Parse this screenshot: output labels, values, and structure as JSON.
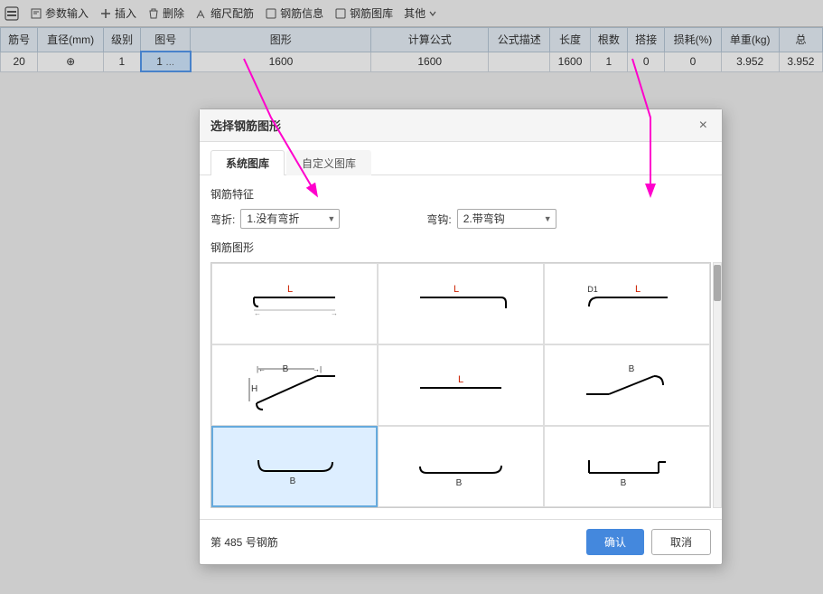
{
  "toolbar": {
    "items": [
      {
        "id": "params-input",
        "label": "参数输入",
        "icon": "edit-icon"
      },
      {
        "id": "insert",
        "label": "插入",
        "icon": "insert-icon"
      },
      {
        "id": "delete",
        "label": "删除",
        "icon": "delete-icon"
      },
      {
        "id": "scale-match",
        "label": "缩尺配筋",
        "icon": "scale-icon"
      },
      {
        "id": "rebar-info",
        "label": "钢筋信息",
        "icon": "info-icon"
      },
      {
        "id": "rebar-lib",
        "label": "钢筋图库",
        "icon": "lib-icon"
      },
      {
        "id": "other",
        "label": "其他",
        "icon": "other-icon"
      }
    ]
  },
  "table": {
    "headers": [
      "筋号",
      "直径(mm)",
      "级别",
      "图号",
      "图形",
      "计算公式",
      "公式描述",
      "长度",
      "根数",
      "搭接",
      "损耗(%)",
      "单重(kg)",
      "总"
    ],
    "row": {
      "jinhao": "20",
      "diameter": "⊕",
      "level": "1",
      "tuhao": "1",
      "tuhao_extra": "...",
      "figure": "1600",
      "formula": "1600",
      "description": "",
      "length": "1600",
      "genshu": "1",
      "dajie": "0",
      "sunhao": "0",
      "weight": "3.952",
      "total": "3.952"
    }
  },
  "modal": {
    "title": "选择钢筋图形",
    "close_label": "×",
    "tabs": [
      {
        "id": "system-lib",
        "label": "系统图库",
        "active": true
      },
      {
        "id": "custom-lib",
        "label": "自定义图库",
        "active": false
      }
    ],
    "props_label": "钢筋特征",
    "bend_label": "弯折:",
    "bend_value": "1.没有弯折",
    "hook_label": "弯钩:",
    "hook_value": "2.带弯钩",
    "shapes_label": "钢筋图形",
    "shapes": [
      {
        "id": 1,
        "row": 0,
        "col": 0,
        "label": "straight-L",
        "selected": false
      },
      {
        "id": 2,
        "row": 0,
        "col": 1,
        "label": "straight-L-hook",
        "selected": false
      },
      {
        "id": 3,
        "row": 0,
        "col": 2,
        "label": "straight-D1-L",
        "selected": false
      },
      {
        "id": 4,
        "row": 1,
        "col": 0,
        "label": "diagonal-BH",
        "selected": false
      },
      {
        "id": 5,
        "row": 1,
        "col": 1,
        "label": "straight-L-center",
        "selected": false
      },
      {
        "id": 6,
        "row": 1,
        "col": 2,
        "label": "diagonal-B-right",
        "selected": false
      },
      {
        "id": 7,
        "row": 2,
        "col": 0,
        "label": "hook-B-selected",
        "selected": true
      },
      {
        "id": 8,
        "row": 2,
        "col": 1,
        "label": "hook-B-2",
        "selected": false
      },
      {
        "id": 9,
        "row": 2,
        "col": 2,
        "label": "hook-B-3",
        "selected": false
      }
    ],
    "footer_info": "第 485 号钢筋",
    "confirm_label": "确认",
    "cancel_label": "取消"
  }
}
